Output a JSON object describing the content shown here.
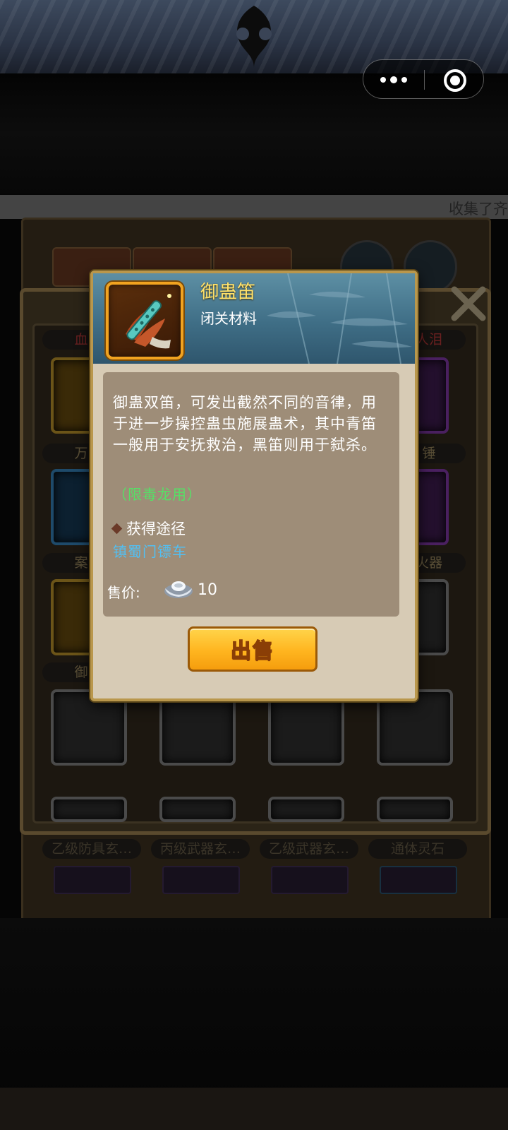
{
  "background": {
    "ticker_text": "收集了齐",
    "slot_labels": {
      "row1_left": "血",
      "row1_right": "人泪",
      "row2_left": "万",
      "row2_right": "锤",
      "row3_left": "案",
      "row3_right": "火器",
      "row4_left": "御",
      "bottom_1": "乙级防具玄…",
      "bottom_2": "丙级武器玄…",
      "bottom_3": "乙级武器玄…",
      "bottom_4": "通体灵石"
    }
  },
  "capsule": {
    "more_icon": "more-dots-icon",
    "close_icon": "target-close-icon"
  },
  "item_popup": {
    "name": "御蛊笛",
    "type": "闭关材料",
    "icon": "flute-item-icon",
    "description": "御蛊双笛，可发出截然不同的音律，用于进一步操控蛊虫施展蛊术，其中青笛一般用于安抚救治，黑笛则用于弑杀。",
    "restriction": "（限毒龙用）",
    "source_title": "获得途径",
    "source_link": "镇蜀门镖车",
    "price_label": "售价:",
    "price_value": "10",
    "price_icon": "silver-ingot-icon",
    "sell_button": "出售"
  },
  "colors": {
    "item_name": "#ffe26b",
    "restriction": "#56e066",
    "source_link": "#52bff2",
    "sell_button": "#ffb51f",
    "rarity_frame": "#f1a320"
  }
}
